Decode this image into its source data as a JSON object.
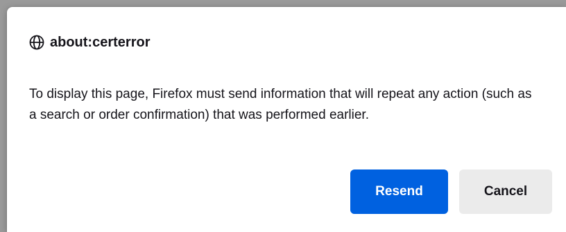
{
  "dialog": {
    "title": "about:certerror",
    "title_icon": "globe-icon",
    "message": "To display this page, Firefox must send information that will repeat any action (such as a search or order confirmation) that was performed earlier.",
    "buttons": {
      "resend_label": "Resend",
      "cancel_label": "Cancel"
    }
  },
  "colors": {
    "primary_button": "#0061e0",
    "secondary_button": "#ebebeb",
    "text": "#15141a"
  }
}
